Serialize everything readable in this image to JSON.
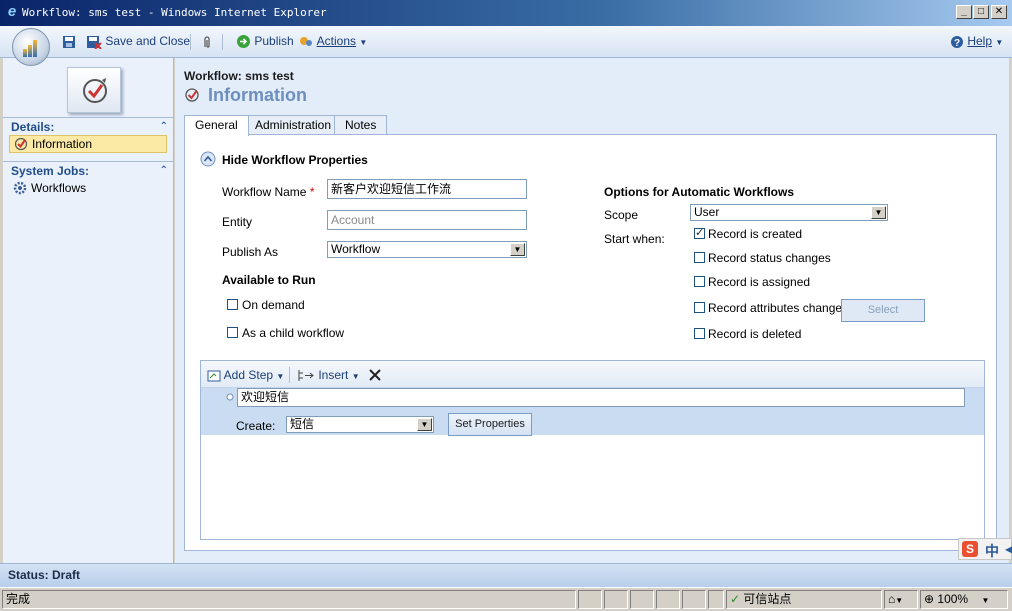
{
  "window": {
    "title": "Workflow: sms test - Windows Internet Explorer"
  },
  "toolbar": {
    "save_close": "Save and Close",
    "publish": "Publish",
    "actions": "Actions",
    "help": "Help"
  },
  "nav": {
    "details_header": "Details:",
    "information": "Information",
    "system_jobs_header": "System Jobs:",
    "workflows": "Workflows"
  },
  "form": {
    "breadcrumb": "Workflow: sms test",
    "title": "Information",
    "tabs": [
      "General",
      "Administration",
      "Notes"
    ],
    "hide_properties": "Hide Workflow Properties",
    "workflow_name_label": "Workflow Name",
    "required_mark": "*",
    "workflow_name_value": "新客户欢迎短信工作流",
    "entity_label": "Entity",
    "entity_value": "Account",
    "publish_as_label": "Publish As",
    "publish_as_value": "Workflow",
    "available_to_run": "Available to Run",
    "on_demand": "On demand",
    "child_workflow": "As a child workflow",
    "options_title": "Options for Automatic Workflows",
    "scope_label": "Scope",
    "scope_value": "User",
    "start_when_label": "Start when:",
    "triggers": [
      {
        "label": "Record is created",
        "checked": true
      },
      {
        "label": "Record status changes",
        "checked": false
      },
      {
        "label": "Record is assigned",
        "checked": false
      },
      {
        "label": "Record attributes change",
        "checked": false
      },
      {
        "label": "Record is deleted",
        "checked": false
      }
    ],
    "select_button": "Select"
  },
  "steps": {
    "add_step": "Add Step",
    "insert": "Insert",
    "step_name": "欢迎短信",
    "create_label": "Create:",
    "create_value": "短信",
    "set_properties": "Set Properties"
  },
  "status": {
    "text": "Status: Draft"
  },
  "ie_status": {
    "done": "完成",
    "zone": "可信站点",
    "zoom": "100%",
    "ime": "中"
  }
}
